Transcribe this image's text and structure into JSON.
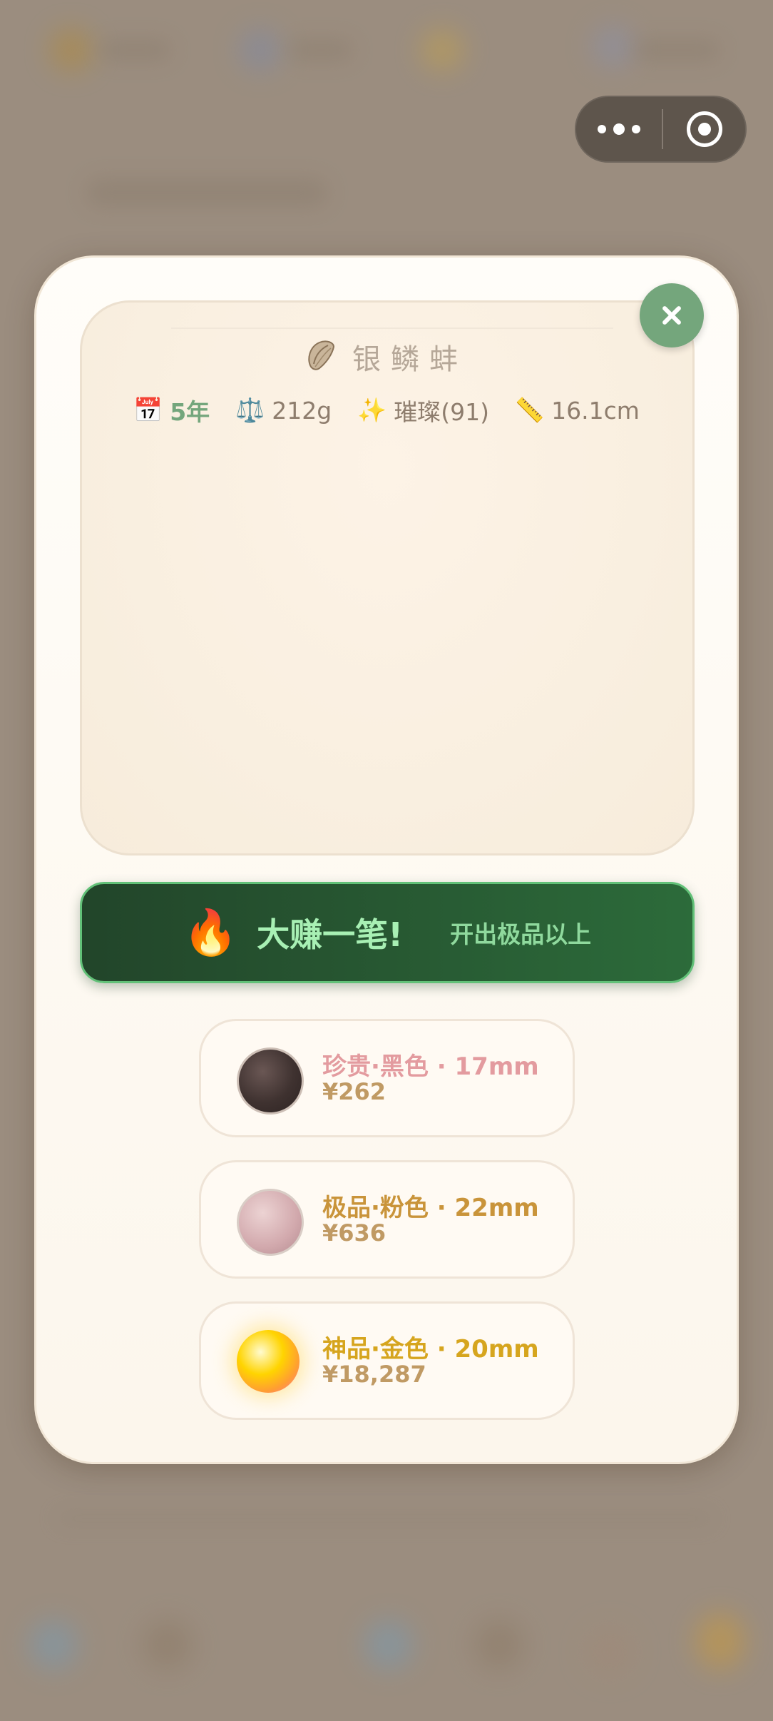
{
  "capsule": {
    "more_icon": "more-dots-icon",
    "target_icon": "target-icon"
  },
  "oyster": {
    "icon": "oyster-icon",
    "name": "银鳞蚌",
    "stats": [
      {
        "icon": "calendar-icon",
        "emoji": "📅",
        "value": "5年",
        "highlight": true
      },
      {
        "icon": "scale-icon",
        "emoji": "⚖️",
        "value": "212g",
        "highlight": false
      },
      {
        "icon": "sparkles-icon",
        "emoji": "✨",
        "value": "璀璨(91)",
        "highlight": false
      },
      {
        "icon": "ruler-icon",
        "emoji": "📏",
        "value": "16.1cm",
        "highlight": false
      }
    ]
  },
  "banner": {
    "icon": "fire-icon",
    "emoji": "🔥",
    "title": "大赚一笔!",
    "subtitle": "开出极品以上"
  },
  "pearls": [
    {
      "label": "珍贵·黑色 · 17mm",
      "price": "¥262",
      "color": "#e39b9f",
      "type": "black"
    },
    {
      "label": "极品·粉色 · 22mm",
      "price": "¥636",
      "color": "#c9943a",
      "type": "pink"
    },
    {
      "label": "神品·金色 · 20mm",
      "price": "¥18,287",
      "color": "#d6a51e",
      "type": "gold"
    }
  ]
}
